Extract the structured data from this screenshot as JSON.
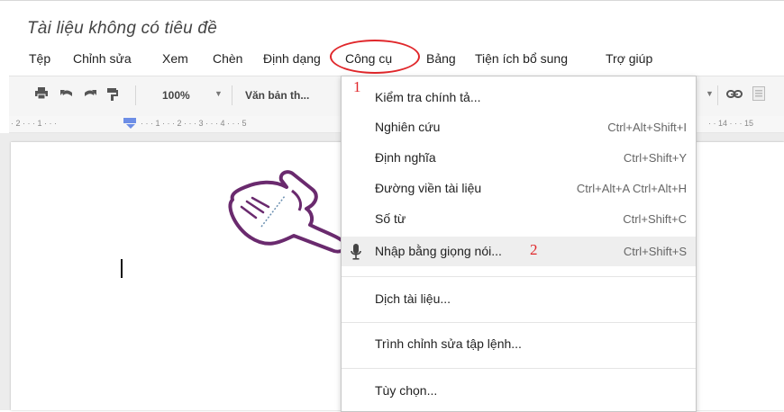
{
  "document": {
    "title": "Tài liệu không có tiêu đề"
  },
  "menubar": {
    "items": [
      {
        "label": "Tệp"
      },
      {
        "label": "Chỉnh sửa"
      },
      {
        "label": "Xem"
      },
      {
        "label": "Chèn"
      },
      {
        "label": "Định dạng"
      },
      {
        "label": "Công cụ"
      },
      {
        "label": "Bảng"
      },
      {
        "label": "Tiện ích bổ sung"
      },
      {
        "label": "Trợ giúp"
      }
    ],
    "active": "Công cụ"
  },
  "toolbar": {
    "zoom": "100%",
    "style": "Văn bản th...",
    "icons": [
      "print-icon",
      "undo-icon",
      "redo-icon",
      "paint-format-icon",
      "link-icon",
      "comment-icon"
    ]
  },
  "ruler": {
    "left_ticks": "· 2 · · · 1 · · ·",
    "right_ticks": "· · · 1 · · · 2 · · · 3 · · · 4 · · · 5",
    "far_right": "· · 14 · · · 15"
  },
  "tools_menu": {
    "items": [
      {
        "label": "Kiểm tra chính tả...",
        "shortcut": ""
      },
      {
        "label": "Nghiên cứu",
        "shortcut": "Ctrl+Alt+Shift+I"
      },
      {
        "label": "Định nghĩa",
        "shortcut": "Ctrl+Shift+Y"
      },
      {
        "label": "Đường viền tài liệu",
        "shortcut": "Ctrl+Alt+A Ctrl+Alt+H"
      },
      {
        "label": "Số từ",
        "shortcut": "Ctrl+Shift+C"
      },
      {
        "label": "Nhập bằng giọng nói...",
        "shortcut": "Ctrl+Shift+S",
        "icon": "microphone-icon",
        "highlighted": true
      },
      {
        "label": "Dịch tài liệu...",
        "shortcut": ""
      },
      {
        "label": "Trình chỉnh sửa tập lệnh...",
        "shortcut": ""
      },
      {
        "label": "Tùy chọn...",
        "shortcut": ""
      }
    ]
  },
  "annotations": {
    "step1": "1",
    "step2": "2",
    "color": "#e0272b"
  }
}
